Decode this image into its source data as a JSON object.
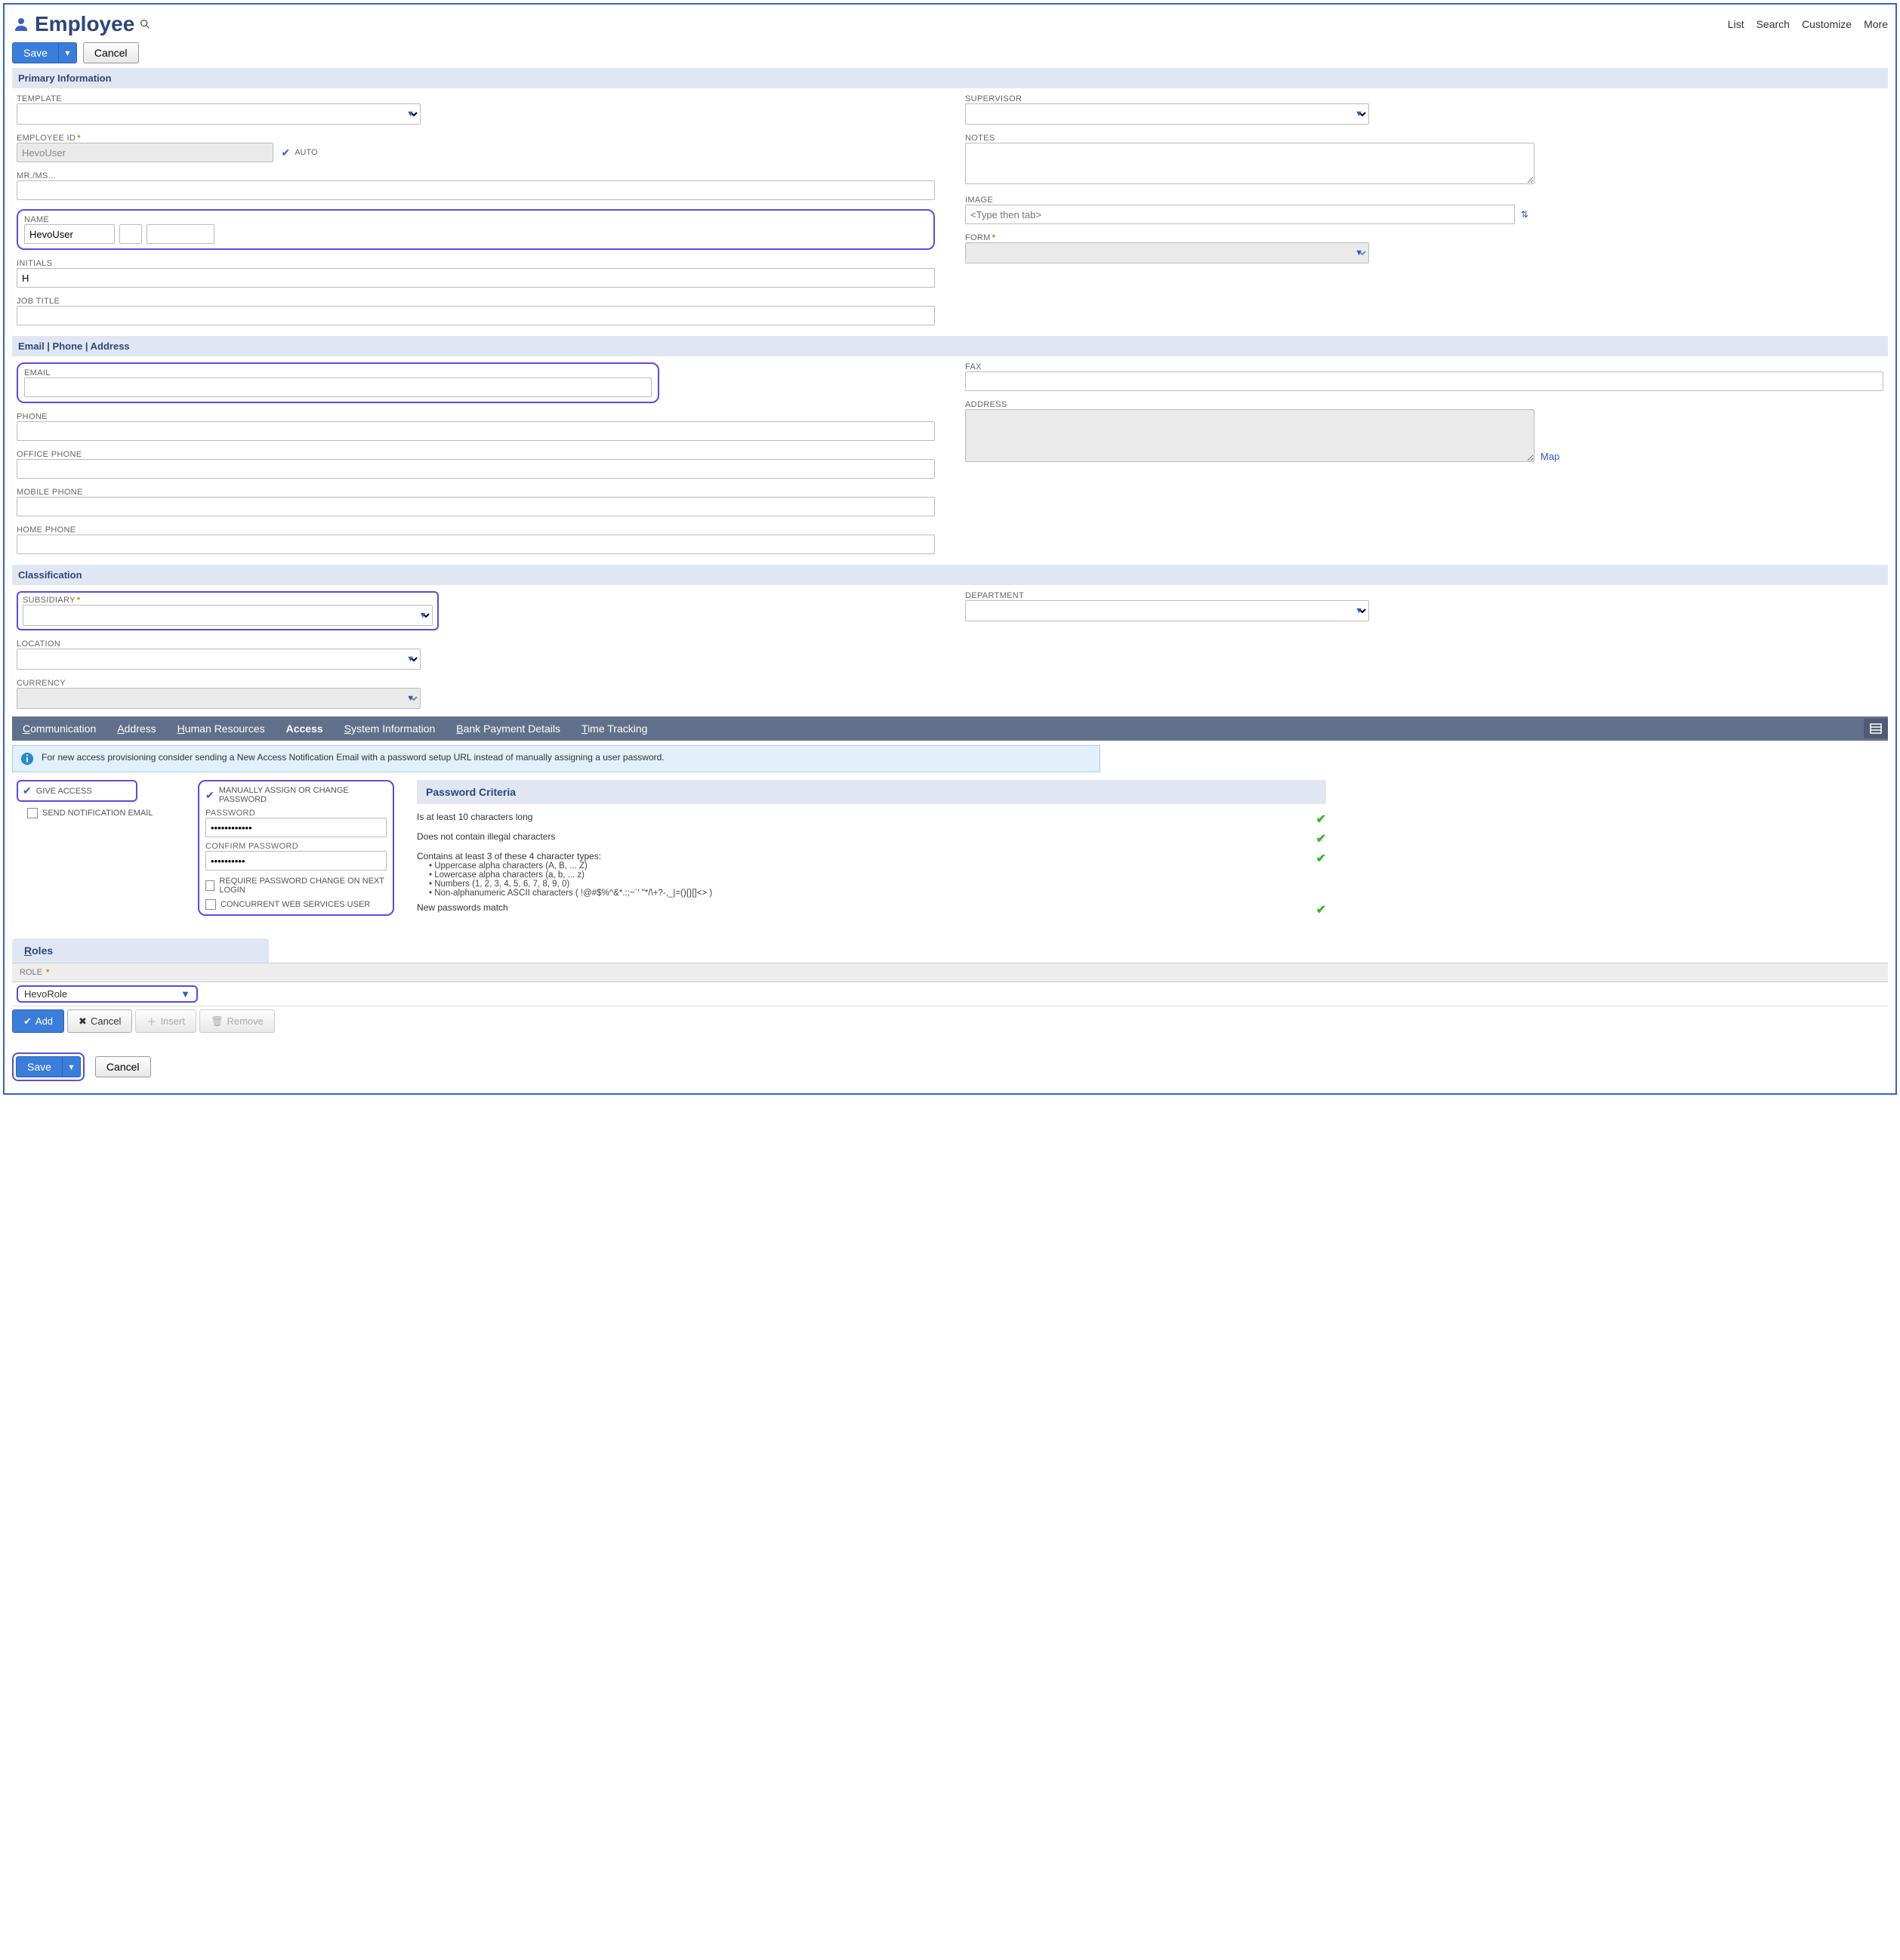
{
  "header": {
    "title": "Employee",
    "top_links": [
      "List",
      "Search",
      "Customize",
      "More"
    ]
  },
  "actions": {
    "save": "Save",
    "cancel": "Cancel"
  },
  "sections": {
    "primary": "Primary Information",
    "contact": "Email | Phone | Address",
    "classification": "Classification"
  },
  "primary": {
    "template_label": "TEMPLATE",
    "employee_id_label": "EMPLOYEE ID",
    "employee_id_value": "HevoUser",
    "auto_label": "AUTO",
    "salutation_label": "MR./MS...",
    "name_label": "NAME",
    "name_first": "HevoUser",
    "initials_label": "INITIALS",
    "initials_value": "H",
    "jobtitle_label": "JOB TITLE",
    "supervisor_label": "SUPERVISOR",
    "notes_label": "NOTES",
    "image_label": "IMAGE",
    "image_placeholder": "<Type then tab>",
    "form_label": "FORM"
  },
  "contact": {
    "email_label": "EMAIL",
    "phone_label": "PHONE",
    "office_phone_label": "OFFICE PHONE",
    "mobile_phone_label": "MOBILE PHONE",
    "home_phone_label": "HOME PHONE",
    "fax_label": "FAX",
    "address_label": "ADDRESS",
    "map_link": "Map"
  },
  "classification": {
    "subsidiary_label": "SUBSIDIARY",
    "location_label": "LOCATION",
    "currency_label": "CURRENCY",
    "department_label": "DEPARTMENT"
  },
  "tabs": {
    "communication": "Communication",
    "address": "Address",
    "hr": "Human Resources",
    "access": "Access",
    "system": "System Information",
    "bank": "Bank Payment Details",
    "time": "Time Tracking"
  },
  "access": {
    "banner": "For new access provisioning consider sending a New Access Notification Email with a password setup URL instead of manually assigning a user password.",
    "give_access": "GIVE ACCESS",
    "send_notification": "SEND NOTIFICATION EMAIL",
    "manual_assign": "MANUALLY ASSIGN OR CHANGE PASSWORD",
    "password_label": "PASSWORD",
    "password_value": "••••••••••••",
    "confirm_password_label": "CONFIRM PASSWORD",
    "confirm_password_value": "••••••••••",
    "require_change": "REQUIRE PASSWORD CHANGE ON NEXT LOGIN",
    "concurrent": "CONCURRENT WEB SERVICES USER",
    "criteria_title": "Password Criteria",
    "crit1": "Is at least 10 characters long",
    "crit2": "Does not contain illegal characters",
    "crit3": "Contains at least 3 of these 4 character types:",
    "crit3a": "• Uppercase alpha characters (A, B, ... Z)",
    "crit3b": "• Lowercase alpha characters (a, b, ... z)",
    "crit3c": "• Numbers (1, 2, 3, 4, 5, 6, 7, 8, 9, 0)",
    "crit3d": "• Non-alphanumeric ASCII characters ( !@#$%^&*.:;~`' \"*/\\+?-,_|=(){}[]<> )",
    "crit4": "New passwords match"
  },
  "roles": {
    "tab_label": "Roles",
    "column": "ROLE",
    "value": "HevoRole",
    "add": "Add",
    "cancel": "Cancel",
    "insert": "Insert",
    "remove": "Remove"
  }
}
